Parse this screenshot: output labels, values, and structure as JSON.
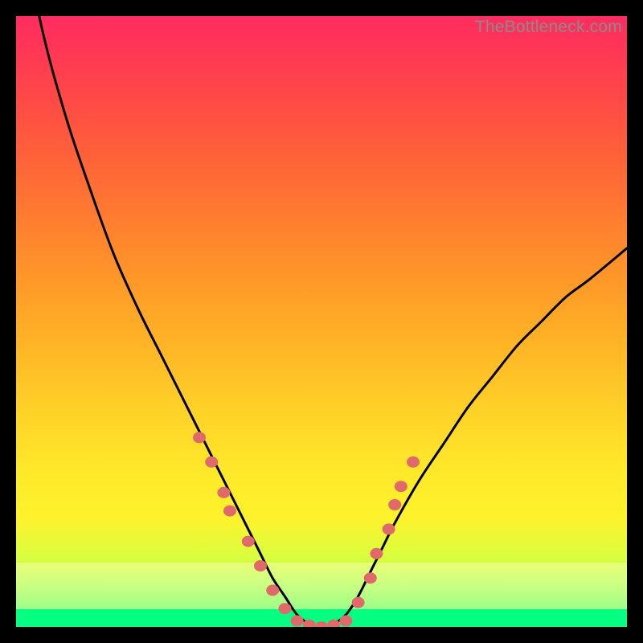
{
  "watermark": "TheBottleneck.com",
  "colors": {
    "curve": "#000000",
    "marker_fill": "#e06a6a",
    "marker_stroke": "#b94f4f",
    "gradient_top": "#ff2d60",
    "gradient_bottom": "#05ff80"
  },
  "chart_data": {
    "type": "line",
    "title": "",
    "xlabel": "",
    "ylabel": "",
    "xlim": [
      0,
      100
    ],
    "ylim": [
      0,
      100
    ],
    "series": [
      {
        "name": "bottleneck-curve",
        "x": [
          0,
          4,
          8,
          12,
          16,
          20,
          24,
          28,
          30,
          32,
          34,
          36,
          38,
          40,
          42,
          44,
          46,
          48,
          50,
          52,
          54,
          56,
          58,
          60,
          62,
          66,
          70,
          74,
          78,
          82,
          86,
          90,
          94,
          100
        ],
        "y": [
          120,
          99,
          84,
          72,
          61,
          52,
          44,
          36,
          32,
          28,
          24,
          20,
          16,
          12,
          8,
          5,
          2,
          0.5,
          0,
          0.5,
          2,
          5,
          9,
          13,
          17,
          24,
          30,
          36,
          41,
          46,
          50,
          54,
          57,
          62
        ]
      }
    ],
    "markers": [
      {
        "x": 30,
        "y": 31
      },
      {
        "x": 32,
        "y": 27
      },
      {
        "x": 34,
        "y": 22
      },
      {
        "x": 35,
        "y": 19
      },
      {
        "x": 38,
        "y": 14
      },
      {
        "x": 40,
        "y": 10
      },
      {
        "x": 42,
        "y": 6
      },
      {
        "x": 44,
        "y": 3
      },
      {
        "x": 46,
        "y": 1
      },
      {
        "x": 48,
        "y": 0.3
      },
      {
        "x": 50,
        "y": 0
      },
      {
        "x": 52,
        "y": 0.3
      },
      {
        "x": 54,
        "y": 1
      },
      {
        "x": 56,
        "y": 4
      },
      {
        "x": 58,
        "y": 8
      },
      {
        "x": 59,
        "y": 12
      },
      {
        "x": 61,
        "y": 16
      },
      {
        "x": 62,
        "y": 20
      },
      {
        "x": 63,
        "y": 23
      },
      {
        "x": 65,
        "y": 27
      }
    ]
  }
}
